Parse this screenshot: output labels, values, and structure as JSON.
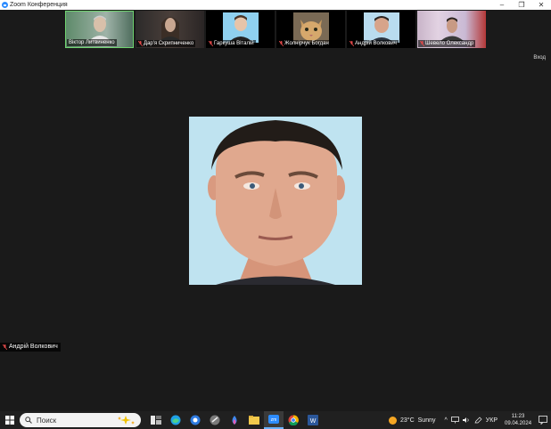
{
  "window": {
    "title": "Zoom Конференция",
    "minimize_glyph": "–",
    "maximize_glyph": "❐",
    "close_glyph": "✕"
  },
  "participants": [
    {
      "name": "Віктор Литвиненко",
      "muted": false,
      "active": true
    },
    {
      "name": "Дар'я Скрипниченко",
      "muted": true,
      "active": false
    },
    {
      "name": "Гаркуша Віталій",
      "muted": true,
      "active": false
    },
    {
      "name": "Жолнірчук Богдан",
      "muted": true,
      "active": false
    },
    {
      "name": "Андрій Волкович",
      "muted": true,
      "active": false
    },
    {
      "name": "Шевело Олександр",
      "muted": true,
      "active": false
    }
  ],
  "enter_button": "Вход",
  "main_speaker": {
    "name": "Андрій Волкович",
    "muted": true
  },
  "taskbar": {
    "search_placeholder": "Поиск",
    "weather_temp": "23°C",
    "weather_desc": "Sunny",
    "language": "УКР",
    "time": "11:23",
    "date": "09.04.2024"
  },
  "colors": {
    "background": "#1a1a1a",
    "active_border": "#6fd36f",
    "mic_off": "#e04848",
    "zoom_blue": "#2d8cff"
  }
}
